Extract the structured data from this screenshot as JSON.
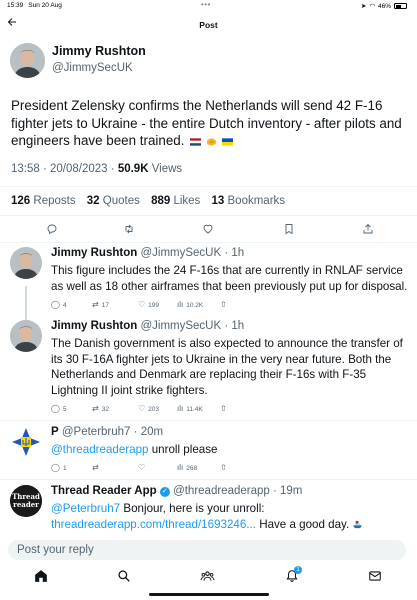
{
  "status_bar": {
    "time": "15:39",
    "date": "Sun 20 Aug",
    "dots": "•••",
    "battery": "46%"
  },
  "header": {
    "back_icon": "arrow-left-icon",
    "title": "Post"
  },
  "main_post": {
    "author_name": "Jimmy Rushton",
    "author_handle": "@JimmySecUK",
    "text": "President Zelensky confirms the Netherlands will send 42 F-16 fighter jets to Ukraine - the entire Dutch inventory - after pilots and engineers have been trained.",
    "emojis": [
      "netherlands-flag",
      "handshake",
      "ukraine-flag"
    ],
    "time": "13:58",
    "date": "20/08/2023",
    "views_count": "50.9K",
    "views_label": "Views",
    "stats": [
      {
        "count": "126",
        "label": "Reposts"
      },
      {
        "count": "32",
        "label": "Quotes"
      },
      {
        "count": "889",
        "label": "Likes"
      },
      {
        "count": "13",
        "label": "Bookmarks"
      }
    ]
  },
  "replies": [
    {
      "author_name": "Jimmy Rushton",
      "author_handle": "@JimmySecUK",
      "age": "1h",
      "text": "This figure includes the 24 F-16s that are currently in RNLAF service as well as 18 other airframes that been previously put up for disposal.",
      "replies": "4",
      "reposts": "17",
      "likes": "199",
      "views": "10.2K"
    },
    {
      "author_name": "Jimmy Rushton",
      "author_handle": "@JimmySecUK",
      "age": "1h",
      "text": "The Danish government is also expected to announce the transfer of its 30 F-16A fighter jets to Ukraine in the very near future. Both the Netherlands and Denmark are replacing their F-16s with F-35 Lightning II joint strike fighters.",
      "replies": "5",
      "reposts": "32",
      "likes": "203",
      "views": "11.4K"
    },
    {
      "author_name": "P",
      "author_handle": "@Peterbruh7",
      "age": "20m",
      "mention": "@threadreaderapp",
      "text": " unroll please",
      "replies": "1",
      "reposts": "",
      "likes": "",
      "views": "268"
    },
    {
      "author_name": "Thread Reader App",
      "author_handle": "@threadreaderapp",
      "age": "19m",
      "avatar_text": [
        "Thread",
        "reader"
      ],
      "mention": "@Peterbruh7",
      "text_1": " Bonjour, here is your unroll: ",
      "link": "threadreaderapp.com/thread/1693246...",
      "text_2": " Have a good day.",
      "emoji": "ship"
    }
  ],
  "reply_bar": {
    "placeholder": "Post your reply"
  },
  "bottom_nav": {
    "items": [
      "home-icon",
      "search-icon",
      "communities-icon",
      "notifications-icon",
      "messages-icon"
    ],
    "notification_count": "1"
  },
  "colors": {
    "accent": "#1d9bf0",
    "secondary_text": "#536471",
    "divider": "#eff3f4"
  }
}
